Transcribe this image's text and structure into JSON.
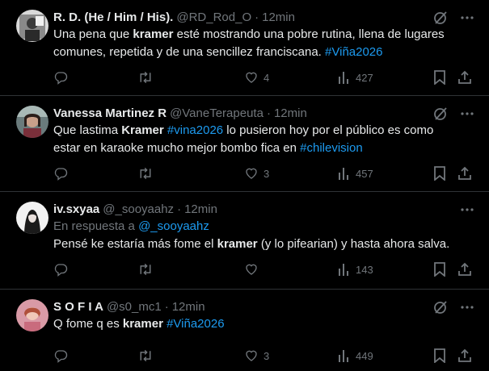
{
  "tweets": [
    {
      "name": "R. D. (He / Him / His).",
      "handle": "@RD_Rod_O",
      "time": "12min",
      "segments": [
        {
          "t": "Una pena que "
        },
        {
          "t": "kramer",
          "b": true
        },
        {
          "t": " esté mostrando una pobre rutina, llena de lugares comunes, repetida y de una sencillez franciscana. "
        },
        {
          "t": "#Viña2026",
          "h": true
        }
      ],
      "likes": "4",
      "views": "427"
    },
    {
      "name": "Vanessa Martinez R",
      "handle": "@VaneTerapeuta",
      "time": "12min",
      "segments": [
        {
          "t": "Que lastima "
        },
        {
          "t": "Kramer",
          "b": true
        },
        {
          "t": " "
        },
        {
          "t": "#vina2026",
          "h": true
        },
        {
          "t": " lo pusieron hoy por el público es como estar en karaoke mucho mejor bombo fica en "
        },
        {
          "t": "#chilevision",
          "h": true
        }
      ],
      "likes": "3",
      "views": "457"
    },
    {
      "name": "iv.sxyaa",
      "handle": "@_sooyaahz",
      "time": "12min",
      "reply_prefix": "En respuesta a ",
      "reply_handle": "@_sooyaahz",
      "segments": [
        {
          "t": "Pensé ke estaría más fome el "
        },
        {
          "t": "kramer",
          "b": true
        },
        {
          "t": " (y lo pifearian) y hasta ahora salva."
        }
      ],
      "likes": "",
      "views": "143"
    },
    {
      "name": "S O F I A",
      "handle": "@s0_mc1",
      "time": "12min",
      "segments": [
        {
          "t": "Q fome q es "
        },
        {
          "t": "kramer",
          "b": true
        },
        {
          "t": "  "
        },
        {
          "t": "#Viña2026",
          "h": true
        }
      ],
      "likes": "3",
      "views": "449"
    }
  ],
  "dot": "·",
  "icons": {
    "grok": "slash-circle-icon",
    "more": "more-dots-icon",
    "reply": "reply-icon",
    "retweet": "retweet-icon",
    "like": "heart-icon",
    "views": "views-bars-icon",
    "bookmark": "bookmark-icon",
    "share": "share-icon"
  },
  "colors": {
    "background": "#000000",
    "text": "#e7e9ea",
    "muted": "#71767b",
    "link": "#1d9bf0",
    "divider": "#2f3336"
  }
}
